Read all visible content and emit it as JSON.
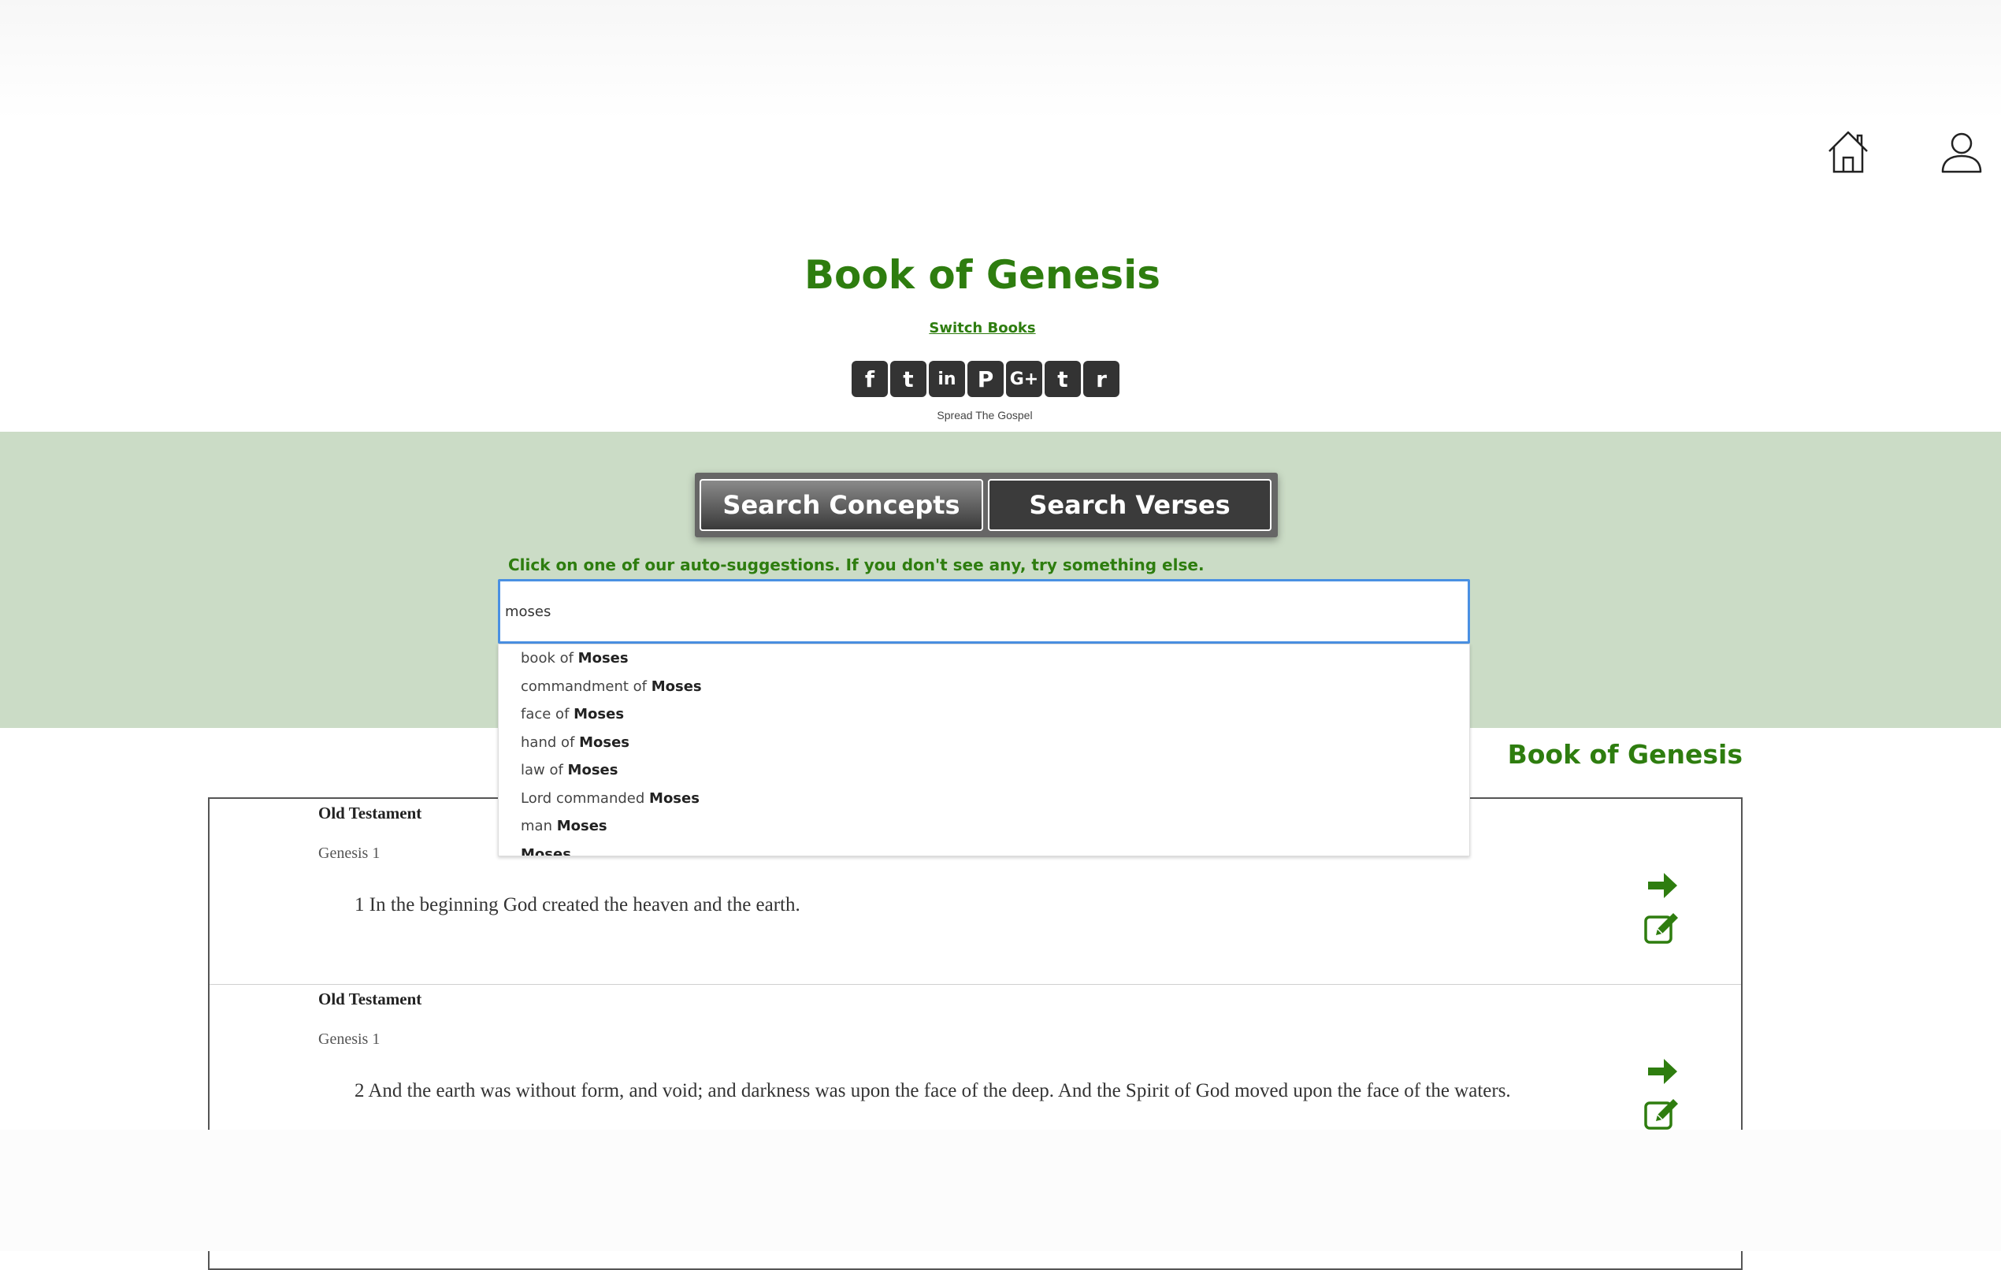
{
  "header": {
    "icons": [
      "home-icon",
      "user-icon"
    ]
  },
  "title": {
    "text": "Book of Genesis",
    "switch_label": "Switch Books"
  },
  "share": {
    "buttons": [
      {
        "name": "facebook",
        "glyph": "f"
      },
      {
        "name": "twitter",
        "glyph": "t"
      },
      {
        "name": "linkedin",
        "glyph": "in"
      },
      {
        "name": "pinterest",
        "glyph": "P"
      },
      {
        "name": "google-plus",
        "glyph": "G+"
      },
      {
        "name": "tumblr",
        "glyph": "t"
      },
      {
        "name": "reddit",
        "glyph": "r"
      }
    ],
    "caption": "Spread The Gospel"
  },
  "search": {
    "tabs": [
      {
        "label": "Search Concepts",
        "active": true
      },
      {
        "label": "Search Verses",
        "active": false
      }
    ],
    "hint": "Click on one of our auto-suggestions. If you don't see any, try something else.",
    "input_value": "moses",
    "suggestions": [
      {
        "prefix": "book of ",
        "match": "Moses"
      },
      {
        "prefix": "commandment of ",
        "match": "Moses"
      },
      {
        "prefix": "face of ",
        "match": "Moses"
      },
      {
        "prefix": "hand of ",
        "match": "Moses"
      },
      {
        "prefix": "law of ",
        "match": "Moses"
      },
      {
        "prefix": "Lord commanded ",
        "match": "Moses"
      },
      {
        "prefix": "man ",
        "match": "Moses"
      },
      {
        "prefix": "",
        "match": "Moses"
      }
    ]
  },
  "results": {
    "heading": "Book of Genesis",
    "verses": [
      {
        "testament": "Old Testament",
        "chapter": "Genesis 1",
        "text": "1  In the beginning God created the heaven and the earth."
      },
      {
        "testament": "Old Testament",
        "chapter": "Genesis 1",
        "text": "2 And the earth was without form, and void; and darkness was upon the face of the deep. And the Spirit of God moved upon the face of the waters."
      }
    ]
  },
  "colors": {
    "accent_green": "#2e7d0f",
    "search_band": "#cbdcc6",
    "input_focus": "#4a90e2"
  }
}
